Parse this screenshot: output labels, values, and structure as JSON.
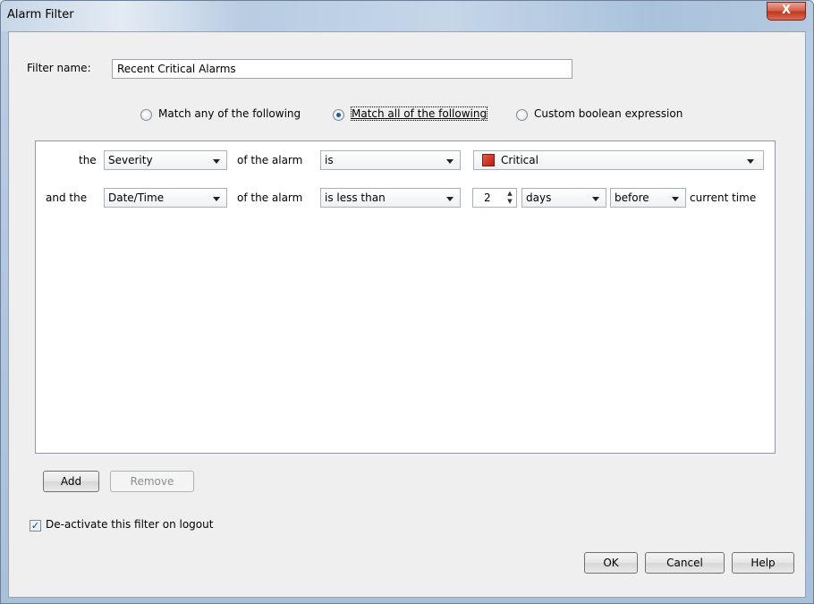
{
  "window": {
    "title": "Alarm Filter",
    "close_glyph": "X"
  },
  "filter": {
    "name_label": "Filter name:",
    "name_value": "Recent Critical Alarms"
  },
  "match_options": [
    {
      "label": "Match any of the following",
      "checked": false
    },
    {
      "label": "Match all of the following",
      "checked": true
    },
    {
      "label": "Custom boolean expression",
      "checked": false
    }
  ],
  "rules": [
    {
      "prefix": "the",
      "field": "Severity",
      "of_text": "of the alarm",
      "operator": "is",
      "value": "Critical",
      "value_color": "#c8281a"
    },
    {
      "prefix": "and the",
      "field": "Date/Time",
      "of_text": "of the alarm",
      "operator": "is less than",
      "amount": "2",
      "unit": "days",
      "relation": "before",
      "suffix": "current time"
    }
  ],
  "actions": {
    "add": "Add",
    "remove": "Remove"
  },
  "deactivate": {
    "label": "De-activate this filter on logout",
    "checked": true
  },
  "footer": {
    "ok": "OK",
    "cancel": "Cancel",
    "help": "Help"
  }
}
